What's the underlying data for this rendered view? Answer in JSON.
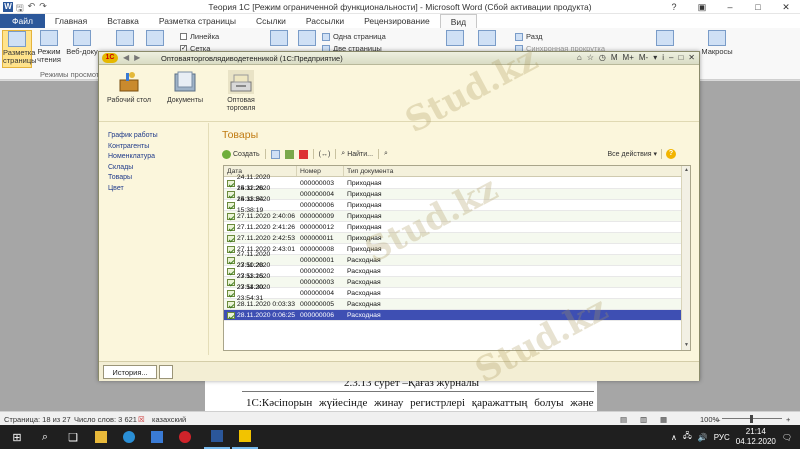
{
  "word": {
    "title": "Теория 1С [Режим ограниченной функциональности] - Microsoft Word (Сбой активации продукта)",
    "app_icon": "W",
    "tabs": [
      "Файл",
      "Главная",
      "Вставка",
      "Разметка страницы",
      "Ссылки",
      "Рассылки",
      "Рецензирование",
      "Вид"
    ],
    "ribbon": {
      "page_layout": "Разметка страницы",
      "reading": "Режим чтения",
      "web": "Веб-доку",
      "group_label": "Режимы просмотр",
      "ruler": "Линейка",
      "grid": "Сетка",
      "one_page": "Одна страница",
      "two_pages": "Две страницы",
      "new": "Разд",
      "sync_scroll": "Синхронная прокрутка",
      "macros": "Макросы"
    },
    "doc_caption": "2.3.13 сурет –Қағаз журналы",
    "doc_paragraph": "1С:Кәсіпорын жүйесінде жинау регистрлері қаражаттың болуы және",
    "status": {
      "page": "Страница: 18 из 27",
      "words": "Число слов: 3 621",
      "language": "казахский",
      "zoom": "100%"
    }
  },
  "onec": {
    "window_title": "Оптоваяторговлядиводетенникой (1С:Предприятие)",
    "sections": [
      {
        "label": "Рабочий стол",
        "icon": "desktop-icon"
      },
      {
        "label": "Документы",
        "icon": "documents-icon"
      },
      {
        "label": "Оптовая торговля",
        "icon": "cash-register-icon"
      }
    ],
    "nav": [
      "График работы",
      "Контрагенты",
      "Номенклатура",
      "Склады",
      "Товары",
      "Цвет"
    ],
    "form_title": "Товары",
    "toolbar": {
      "create": "Создать",
      "find": "Найти...",
      "all_actions": "Все действия"
    },
    "columns": [
      "Дата",
      "Номер",
      "Тип документа"
    ],
    "rows": [
      {
        "date": "24.11.2020 15:32:26",
        "num": "000000003",
        "type": "Приходная"
      },
      {
        "date": "24.11.2020 15:33:54",
        "num": "000000004",
        "type": "Приходная"
      },
      {
        "date": "24.11.2020 15:38:19",
        "num": "000000006",
        "type": "Приходная"
      },
      {
        "date": "27.11.2020 2:40:06",
        "num": "000000009",
        "type": "Приходная"
      },
      {
        "date": "27.11.2020 2:41:26",
        "num": "000000012",
        "type": "Приходная"
      },
      {
        "date": "27.11.2020 2:42:53",
        "num": "000000011",
        "type": "Приходная"
      },
      {
        "date": "27.11.2020 2:43:01",
        "num": "000000008",
        "type": "Приходная"
      },
      {
        "date": "27.11.2020 23:50:28",
        "num": "000000001",
        "type": "Расходная"
      },
      {
        "date": "27.11.2020 23:53:15",
        "num": "000000002",
        "type": "Расходная"
      },
      {
        "date": "27.11.2020 23:54:30",
        "num": "000000003",
        "type": "Расходная"
      },
      {
        "date": "27.11.2020 23:54:31",
        "num": "000000004",
        "type": "Расходная"
      },
      {
        "date": "28.11.2020 0:03:33",
        "num": "000000005",
        "type": "Расходная"
      },
      {
        "date": "28.11.2020 0:06:25",
        "num": "000000006",
        "type": "Расходная"
      }
    ],
    "history_button": "История..."
  },
  "taskbar": {
    "lang": "РУС",
    "time": "21:14",
    "date": "04.12.2020"
  },
  "watermark": "Stud.kz",
  "colors": {
    "word_blue": "#2b579a",
    "onec_bg": "#fbf6dc",
    "selected_row": "#3e4fb3",
    "title_orange": "#c07a10"
  }
}
